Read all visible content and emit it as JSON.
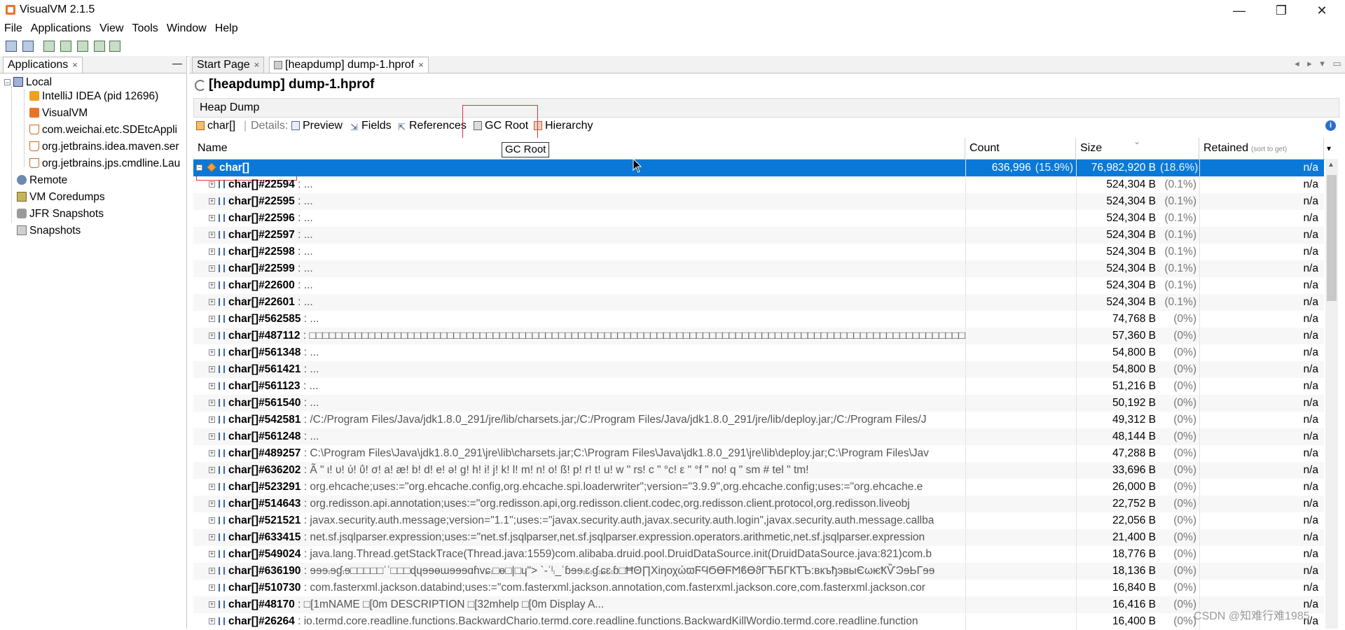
{
  "window": {
    "title": "VisualVM 2.1.5",
    "controls": [
      "—",
      "❐",
      "✕"
    ]
  },
  "menu": [
    "File",
    "Applications",
    "View",
    "Tools",
    "Window",
    "Help"
  ],
  "left_panel": {
    "tab_label": "Applications",
    "tab_close": "×",
    "minimize": "—",
    "tree": [
      {
        "label": "Local",
        "icon": "computer-icon",
        "level": 0
      },
      {
        "label": "IntelliJ IDEA (pid 12696)",
        "icon": "intellij-icon",
        "level": 2
      },
      {
        "label": "VisualVM",
        "icon": "visualvm-icon",
        "level": 2
      },
      {
        "label": "com.weichai.etc.SDEtcAppli",
        "icon": "java-icon",
        "level": 2
      },
      {
        "label": "org.jetbrains.idea.maven.ser",
        "icon": "java-icon",
        "level": 2
      },
      {
        "label": "org.jetbrains.jps.cmdline.Lau",
        "icon": "java-icon",
        "level": 2
      },
      {
        "label": "Remote",
        "icon": "remote-icon",
        "level": 0
      },
      {
        "label": "VM Coredumps",
        "icon": "coredump-icon",
        "level": 0
      },
      {
        "label": "JFR Snapshots",
        "icon": "jfr-icon",
        "level": 0
      },
      {
        "label": "Snapshots",
        "icon": "snapshot-icon",
        "level": 0
      }
    ]
  },
  "doc_tabs": [
    {
      "label": "Start Page",
      "active": false
    },
    {
      "label": "[heapdump] dump-1.hprof",
      "active": true
    }
  ],
  "tab_nav": "◂ ▸ ▾ ▭",
  "heading": "[heapdump] dump-1.hprof",
  "section_label": "Heap Dump",
  "details_bar": {
    "class_name": "char[]",
    "separator": "|",
    "details_label": "Details:",
    "buttons": [
      "Preview",
      "Fields",
      "References",
      "GC Root",
      "Hierarchy"
    ]
  },
  "tooltip": "GC Root",
  "info_icon": "i",
  "table": {
    "columns": {
      "name": "Name",
      "count": "Count",
      "size": "Size",
      "retained": "Retained",
      "retained_hint": "(sort to get)"
    },
    "sort_arrow": "⌄",
    "header_menu": "▾",
    "rows": [
      {
        "name": "char[]",
        "value": "",
        "count": "636,996",
        "count_pct": "(15.9%)",
        "size": "76,982,920 B",
        "size_pct": "(18.6%)",
        "retained": "n/a",
        "selected": true
      },
      {
        "name": "char[]#22594",
        "value": " : ...",
        "size": "524,304 B",
        "size_pct": "(0.1%)",
        "retained": "n/a"
      },
      {
        "name": "char[]#22595",
        "value": " : ...",
        "size": "524,304 B",
        "size_pct": "(0.1%)",
        "retained": "n/a"
      },
      {
        "name": "char[]#22596",
        "value": " : ...",
        "size": "524,304 B",
        "size_pct": "(0.1%)",
        "retained": "n/a"
      },
      {
        "name": "char[]#22597",
        "value": " : ...",
        "size": "524,304 B",
        "size_pct": "(0.1%)",
        "retained": "n/a"
      },
      {
        "name": "char[]#22598",
        "value": " : ...",
        "size": "524,304 B",
        "size_pct": "(0.1%)",
        "retained": "n/a"
      },
      {
        "name": "char[]#22599",
        "value": " : ...",
        "size": "524,304 B",
        "size_pct": "(0.1%)",
        "retained": "n/a"
      },
      {
        "name": "char[]#22600",
        "value": " : ...",
        "size": "524,304 B",
        "size_pct": "(0.1%)",
        "retained": "n/a"
      },
      {
        "name": "char[]#22601",
        "value": " : ...",
        "size": "524,304 B",
        "size_pct": "(0.1%)",
        "retained": "n/a"
      },
      {
        "name": "char[]#562585",
        "value": " : ...",
        "size": "74,768 B",
        "size_pct": "(0%)",
        "retained": "n/a"
      },
      {
        "name": "char[]#487112",
        "value": " : □□□□□□□□□□□□□□□□□□□□□□□□□□□□□□□□□□□□□□□□□□□□□□□□□□□□□□□□□□□□□□□□□□□□□□□□□□□□□□□□□□□□□□□□□□□□□□□□□□□□□□□□□□",
        "size": "57,360 B",
        "size_pct": "(0%)",
        "retained": "n/a"
      },
      {
        "name": "char[]#561348",
        "value": " : ...",
        "size": "54,800 B",
        "size_pct": "(0%)",
        "retained": "n/a"
      },
      {
        "name": "char[]#561421",
        "value": " : ...",
        "size": "54,800 B",
        "size_pct": "(0%)",
        "retained": "n/a"
      },
      {
        "name": "char[]#561123",
        "value": " : ...",
        "size": "51,216 B",
        "size_pct": "(0%)",
        "retained": "n/a"
      },
      {
        "name": "char[]#561540",
        "value": " : ...",
        "size": "50,192 B",
        "size_pct": "(0%)",
        "retained": "n/a"
      },
      {
        "name": "char[]#542581",
        "value": " : /C:/Program Files/Java/jdk1.8.0_291/jre/lib/charsets.jar;/C:/Program Files/Java/jdk1.8.0_291/jre/lib/deploy.jar;/C:/Program Files/J",
        "size": "49,312 B",
        "size_pct": "(0%)",
        "retained": "n/a"
      },
      {
        "name": "char[]#561248",
        "value": " : ...",
        "size": "48,144 B",
        "size_pct": "(0%)",
        "retained": "n/a"
      },
      {
        "name": "char[]#489257",
        "value": " : C:\\Program Files\\Java\\jdk1.8.0_291\\jre\\lib\\charsets.jar;C:\\Program Files\\Java\\jdk1.8.0_291\\jre\\lib\\deploy.jar;C:\\Program Files\\Jav",
        "size": "47,288 B",
        "size_pct": "(0%)",
        "retained": "n/a"
      },
      {
        "name": "char[]#636202",
        "value": " : Ã \" ι! υ! ύ! ΰ! σ! a! æ! b! d! e! ə! g! h! i! j! k! l! m! n! o! ß! p! r! t! u! w \" rs! c \" °c! ε \" °f \" no! q \" sm # tel \" tm!",
        "size": "33,696 B",
        "size_pct": "(0%)",
        "retained": "n/a"
      },
      {
        "name": "char[]#523291",
        "value": " : org.ehcache;uses:=\"org.ehcache.config,org.ehcache.spi.loaderwriter\";version=\"3.9.9\",org.ehcache.config;uses:=\"org.ehcache.e",
        "size": "26,000 B",
        "size_pct": "(0%)",
        "retained": "n/a"
      },
      {
        "name": "char[]#514643",
        "value": " : org.redisson.api.annotation;uses:=\"org.redisson.api,org.redisson.client.codec,org.redisson.client.protocol,org.redisson.liveobj",
        "size": "22,752 B",
        "size_pct": "(0%)",
        "retained": "n/a"
      },
      {
        "name": "char[]#521521",
        "value": " : javax.security.auth.message;version=\"1.1\";uses:=\"javax.security.auth,javax.security.auth.login\",javax.security.auth.message.callba",
        "size": "22,056 B",
        "size_pct": "(0%)",
        "retained": "n/a"
      },
      {
        "name": "char[]#633415",
        "value": " : net.sf.jsqlparser.expression;uses:=\"net.sf.jsqlparser,net.sf.jsqlparser.expression.operators.arithmetic,net.sf.jsqlparser.expression",
        "size": "21,400 B",
        "size_pct": "(0%)",
        "retained": "n/a"
      },
      {
        "name": "char[]#549024",
        "value": " : java.lang.Thread.getStackTrace(Thread.java:1559)com.alibaba.druid.pool.DruidDataSource.init(DruidDataSource.java:821)com.b",
        "size": "18,776 B",
        "size_pct": "(0%)",
        "retained": "n/a"
      },
      {
        "name": "char[]#636190",
        "value": " : ɘɘɘ⨾ɘɠ⨾ɘ□□□□□ʿʿ□□□ɖɥɘɘɵɯɘɘɘɑɦvɕ⨾□ɵ□|□ɥ\"> `-ʿˡ⨾_ʿɓɘɘ⨾ɛ⨾ɠ⨾ɕɛ⨾ɓ□ĦΘ∏ΧiηοχώϖϜϤϬϴϜϺϐϴϑΓЋБГКТЪ:вкъђэвыЄωѥҞѶϿɘЬΓɘɘ",
        "size": "18,136 B",
        "size_pct": "(0%)",
        "retained": "n/a"
      },
      {
        "name": "char[]#510730",
        "value": " : com.fasterxml.jackson.databind;uses:=\"com.fasterxml.jackson.annotation,com.fasterxml.jackson.core,com.fasterxml.jackson.cor",
        "size": "16,840 B",
        "size_pct": "(0%)",
        "retained": "n/a"
      },
      {
        "name": "char[]#48170",
        "value": " : □[1mNAME       □[0m  DESCRIPTION                                                                 □[32mhelp       □[0m  Display A...",
        "size": "16,416 B",
        "size_pct": "(0%)",
        "retained": "n/a"
      },
      {
        "name": "char[]#26264",
        "value": " : io.termd.core.readline.functions.BackwardChario.termd.core.readline.functions.BackwardKillWordio.termd.core.readline.function",
        "size": "16,400 B",
        "size_pct": "(0%)",
        "retained": "n/a"
      }
    ]
  },
  "watermark": "CSDN @知难行难1985"
}
